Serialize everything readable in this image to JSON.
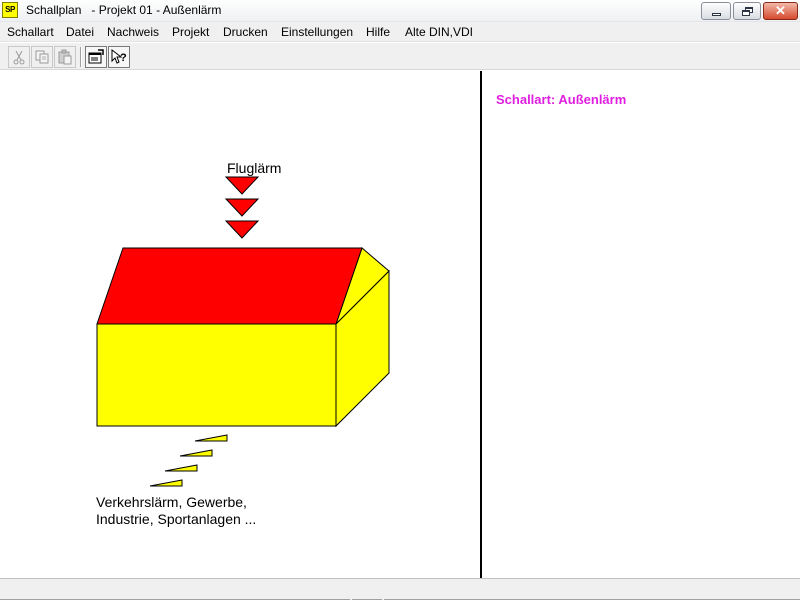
{
  "window": {
    "app_icon_text": "SP",
    "title": "Schallplan   - Projekt 01 - Außenlärm",
    "close_glyph": "✕"
  },
  "menu": {
    "items": [
      "Schallart",
      "Datei",
      "Nachweis",
      "Projekt",
      "Drucken",
      "Einstellungen",
      "Hilfe",
      "Alte DIN,VDI"
    ]
  },
  "toolbar": {
    "buttons": [
      "cut-icon",
      "copy-icon",
      "paste-icon",
      "properties-icon",
      "context-help-icon"
    ]
  },
  "main": {
    "schallart_label": "Schallart: Außenlärm",
    "flug_label": "Fluglärm",
    "ground_label_line1": "Verkehrslärm, Gewerbe,",
    "ground_label_line2": "Industrie, Sportanlagen ..."
  },
  "colors": {
    "roof": "#ff0000",
    "walls": "#ffff00",
    "schallart_accent": "#e020e0"
  }
}
